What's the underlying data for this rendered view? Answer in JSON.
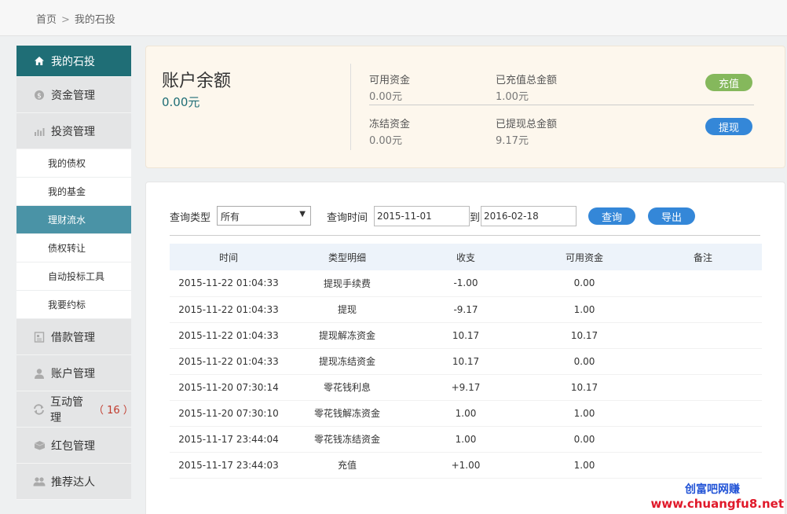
{
  "breadcrumb": {
    "home": "首页",
    "separator": ">",
    "current": "我的石投"
  },
  "sidebar": {
    "top": {
      "label": "我的石投",
      "icon": "home-icon"
    },
    "funds": {
      "label": "资金管理",
      "icon": "coin-icon"
    },
    "invest": {
      "label": "投资管理",
      "icon": "bar-chart-icon",
      "subitems": [
        "我的债权",
        "我的基金",
        "理财流水",
        "债权转让",
        "自动投标工具",
        "我要约标"
      ]
    },
    "loan": {
      "label": "借款管理",
      "icon": "document-icon"
    },
    "account": {
      "label": "账户管理",
      "icon": "user-icon"
    },
    "interact": {
      "label": "互动管理",
      "icon": "refresh-icon",
      "badge": "（ 16 ）"
    },
    "redpacket": {
      "label": "红包管理",
      "icon": "gift-icon"
    },
    "referral": {
      "label": "推荐达人",
      "icon": "users-icon"
    }
  },
  "balance": {
    "title": "账户余额",
    "value": "0.00元",
    "available_label": "可用资金",
    "available_value": "0.00元",
    "recharged_label": "已充值总金额",
    "recharged_value": "1.00元",
    "frozen_label": "冻结资金",
    "frozen_value": "0.00元",
    "withdrawn_label": "已提现总金额",
    "withdrawn_value": "9.17元",
    "recharge_btn": "充值",
    "withdraw_btn": "提现"
  },
  "query": {
    "type_label": "查询类型",
    "type_value": "所有",
    "time_label": "查询时间",
    "start_date": "2015-11-01",
    "to_label": "到",
    "end_date": "2016-02-18",
    "search_btn": "查询",
    "export_btn": "导出"
  },
  "table": {
    "headers": [
      "时间",
      "类型明细",
      "收支",
      "可用资金",
      "备注"
    ],
    "rows": [
      [
        "2015-11-22 01:04:33",
        "提现手续费",
        "-1.00",
        "0.00",
        ""
      ],
      [
        "2015-11-22 01:04:33",
        "提现",
        "-9.17",
        "1.00",
        ""
      ],
      [
        "2015-11-22 01:04:33",
        "提现解冻资金",
        "10.17",
        "10.17",
        ""
      ],
      [
        "2015-11-22 01:04:33",
        "提现冻结资金",
        "10.17",
        "0.00",
        ""
      ],
      [
        "2015-11-20 07:30:14",
        "零花钱利息",
        "+9.17",
        "10.17",
        ""
      ],
      [
        "2015-11-20 07:30:10",
        "零花钱解冻资金",
        "1.00",
        "1.00",
        ""
      ],
      [
        "2015-11-17 23:44:04",
        "零花钱冻结资金",
        "1.00",
        "0.00",
        ""
      ],
      [
        "2015-11-17 23:44:03",
        "充值",
        "+1.00",
        "1.00",
        ""
      ]
    ],
    "amount_colors": [
      "red",
      "red",
      "blue",
      "blue",
      "green",
      "blue",
      "blue",
      "green"
    ]
  },
  "watermark": {
    "cn": "创富吧网赚",
    "url": "www.chuangfu8.net"
  },
  "colors": {
    "accent": "#1f6e76",
    "sub_active": "#4a93a6",
    "button_blue": "#3487d8",
    "button_green": "#85b85c"
  }
}
